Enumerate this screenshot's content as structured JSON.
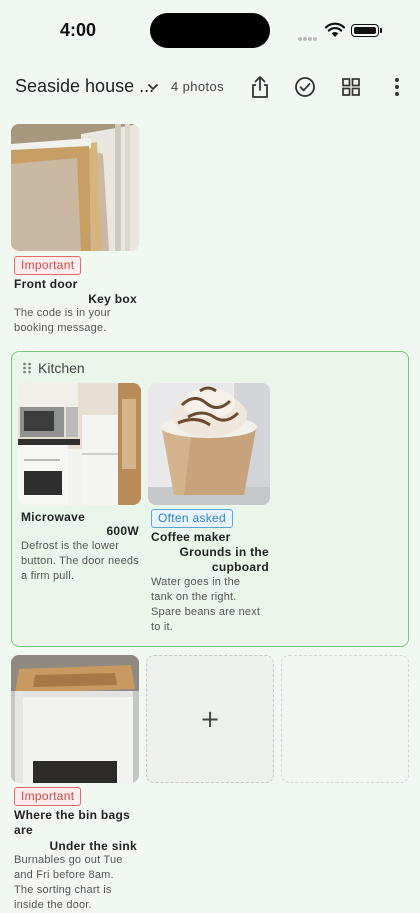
{
  "status": {
    "time": "4:00"
  },
  "header": {
    "album_title": "Seaside house ...",
    "photo_count": "4 photos"
  },
  "tiles": [
    {
      "badge": "Important",
      "title": "Front door",
      "value": "Key box",
      "description": "The code is in your booking message."
    },
    {
      "badge": "Important",
      "title": "Where the bin bags are",
      "value": "Under the sink",
      "description": "Burnables go out Tue and Fri before 8am. The sorting chart is inside the door."
    }
  ],
  "group": {
    "title": "Kitchen",
    "tiles": [
      {
        "title": "Microwave",
        "value": "600W",
        "description": "Defrost is the lower button. The door needs a firm pull."
      },
      {
        "badge": "Often asked",
        "title": "Coffee maker",
        "value": "Grounds in the cupboard",
        "description": "Water goes in the tank on the right. Spare beans are next to it."
      }
    ]
  },
  "add_tile": {
    "glyph": "+"
  },
  "colors": {
    "background": "#f1f8f1",
    "group_border": "#7cc67c",
    "important": "#d24747",
    "often_asked": "#2a84c2"
  },
  "icons": [
    "share-icon",
    "check-circle-icon",
    "grid-icon",
    "more-vert-icon",
    "chevron-down-icon",
    "drag-handle-icon",
    "plus-icon"
  ]
}
